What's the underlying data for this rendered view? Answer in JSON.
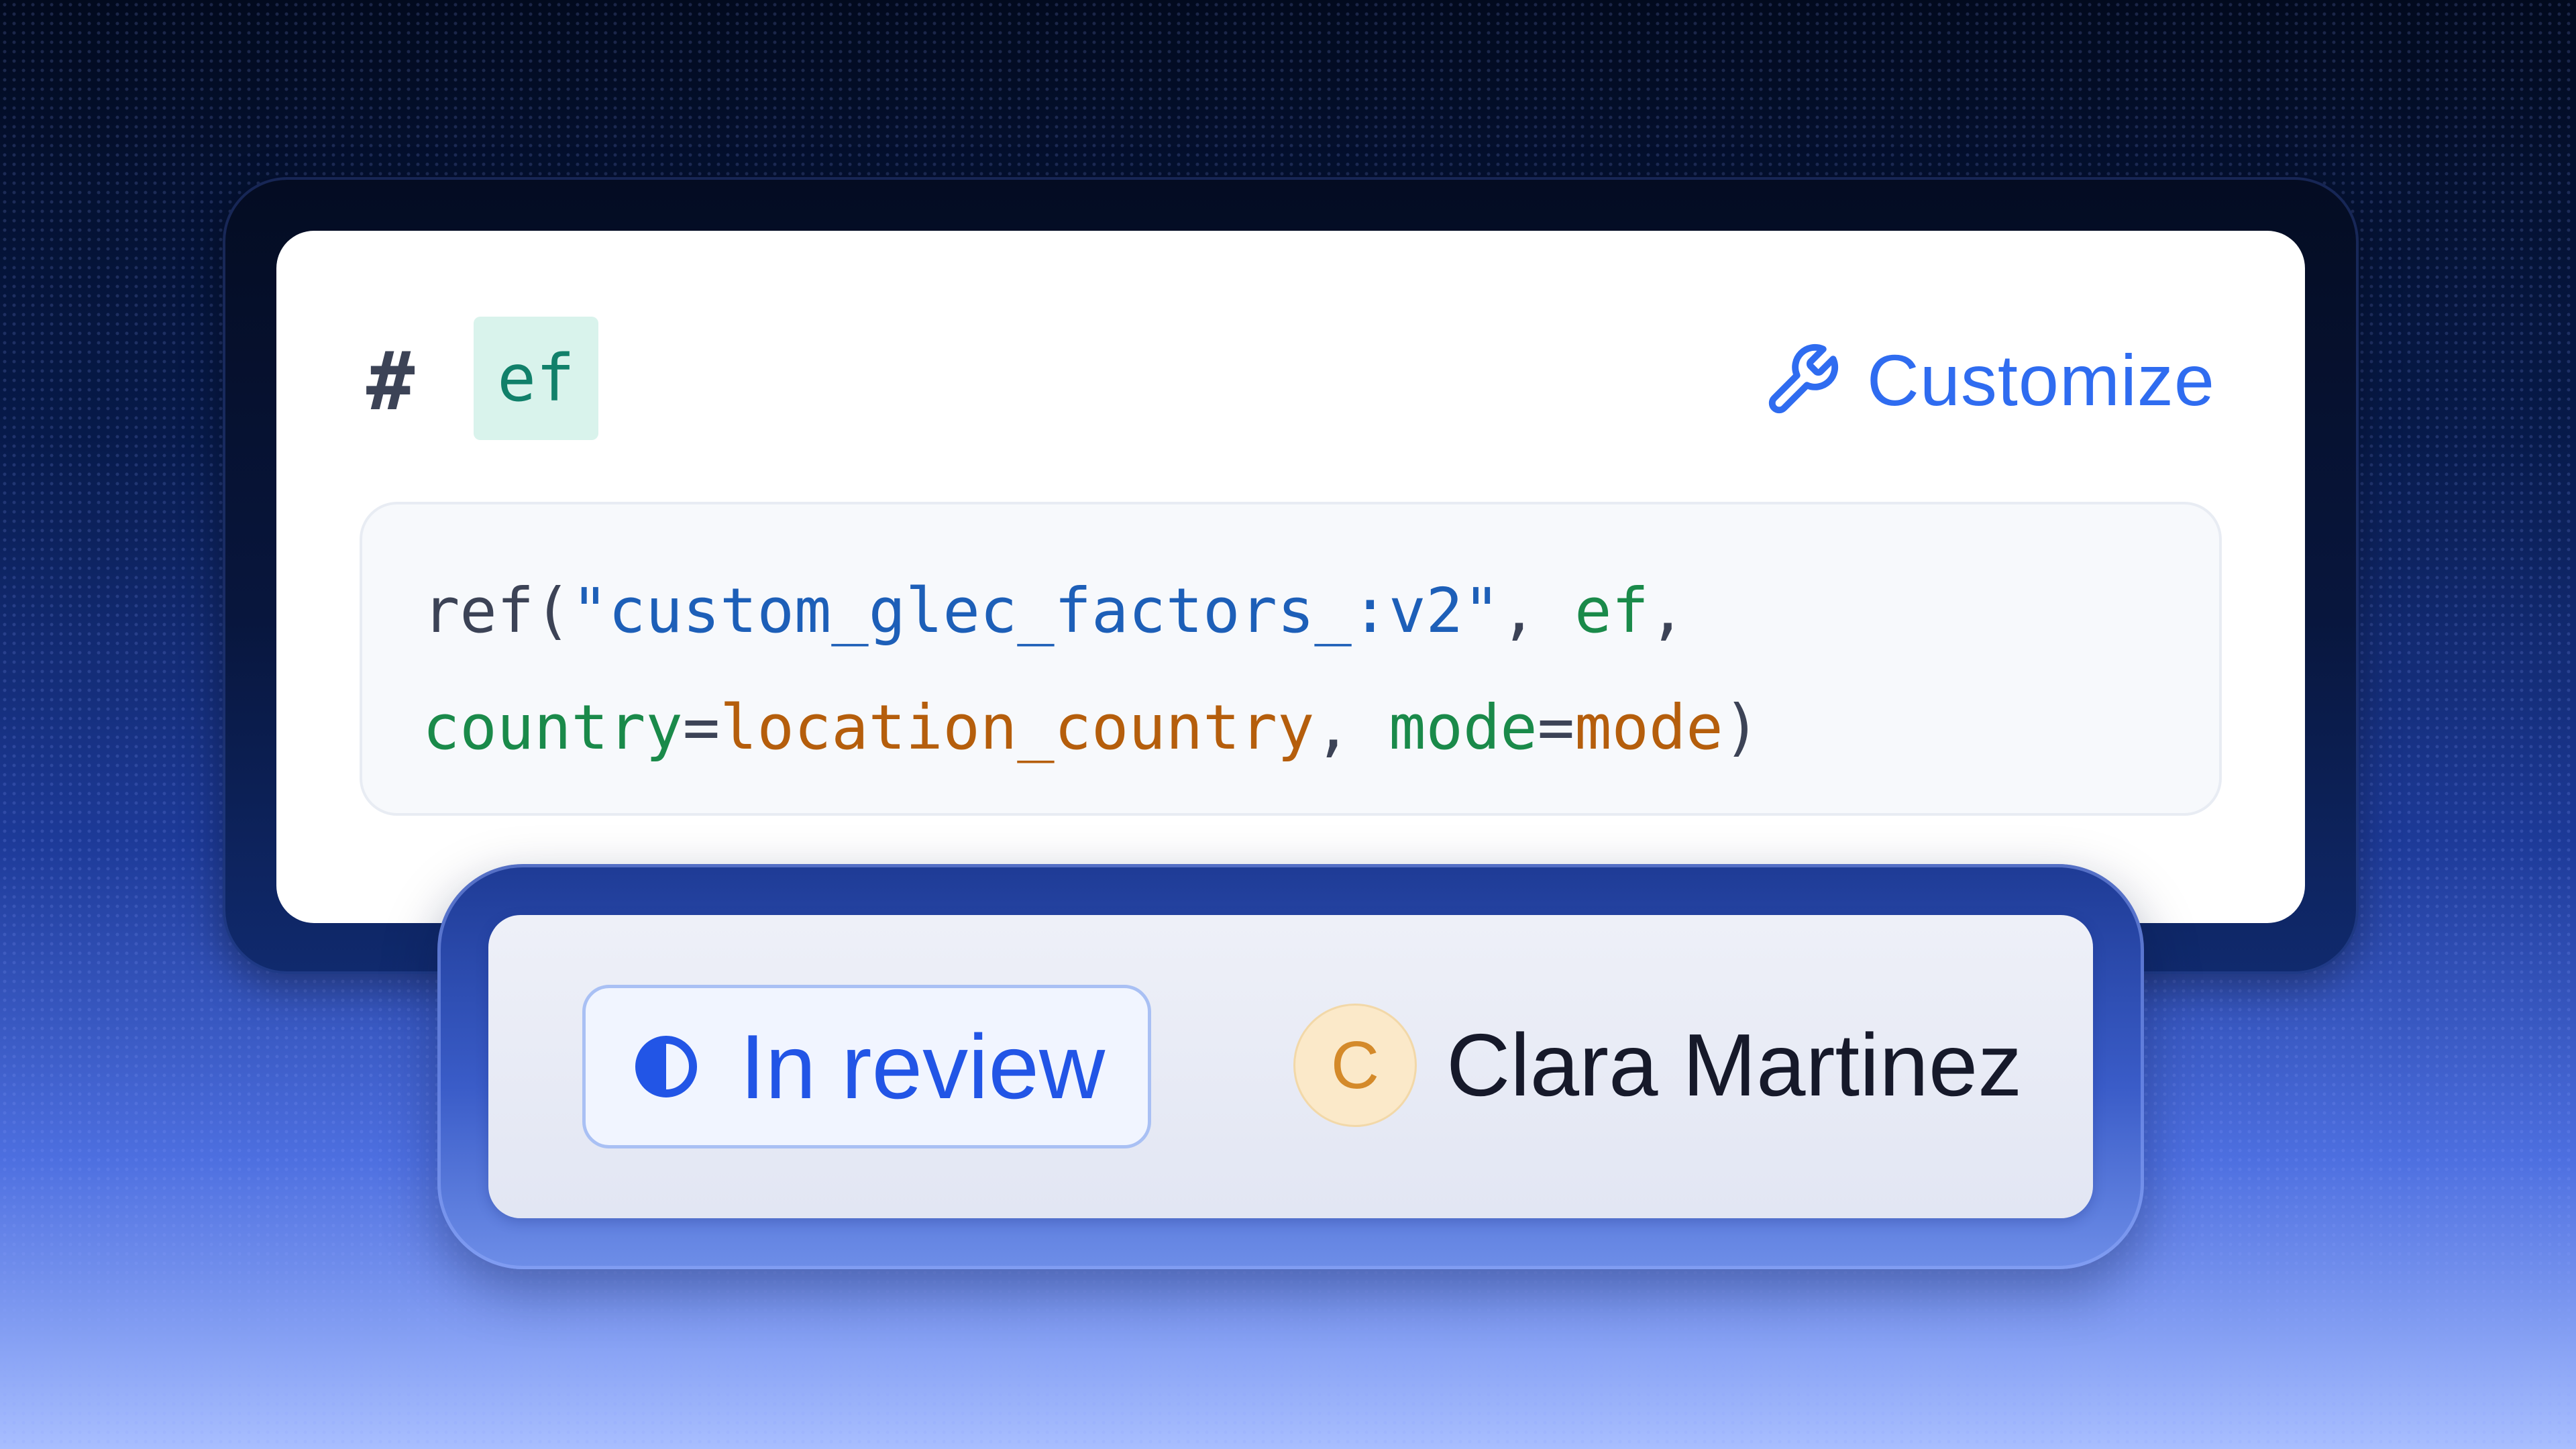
{
  "field": {
    "hash_symbol": "#",
    "variable_name": "ef",
    "customize_label": "Customize",
    "customize_icon": "wrench-icon"
  },
  "code": {
    "line1": [
      {
        "text": "ref(",
        "kind": "plain"
      },
      {
        "text": "\"custom_glec_factors_:v2\"",
        "kind": "string"
      },
      {
        "text": ", ",
        "kind": "plain"
      },
      {
        "text": "ef",
        "kind": "id"
      },
      {
        "text": ",",
        "kind": "plain"
      }
    ],
    "line2": [
      {
        "text": "country",
        "kind": "id"
      },
      {
        "text": "=",
        "kind": "plain"
      },
      {
        "text": "location_country",
        "kind": "val"
      },
      {
        "text": ", ",
        "kind": "plain"
      },
      {
        "text": "mode",
        "kind": "id"
      },
      {
        "text": "=",
        "kind": "plain"
      },
      {
        "text": "mode",
        "kind": "val"
      },
      {
        "text": ")",
        "kind": "plain"
      }
    ]
  },
  "status": {
    "label": "In review",
    "icon": "half-circle-icon",
    "color": "#2255e6"
  },
  "assignee": {
    "initial": "C",
    "name": "Clara Martinez"
  },
  "colors": {
    "accent": "#2f6cf0",
    "string": "#1d5fb8",
    "identifier": "#1a8a4a",
    "value": "#b55e0c"
  }
}
